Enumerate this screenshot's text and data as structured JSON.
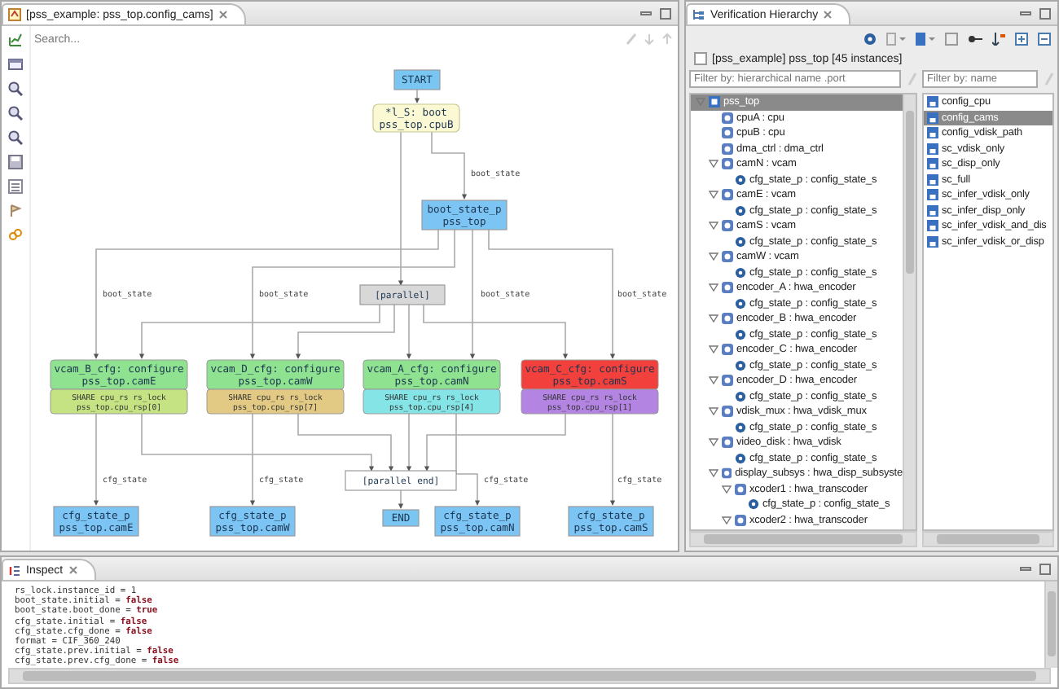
{
  "editor": {
    "tab_title": "[pss_example: pss_top.config_cams]",
    "search": {
      "placeholder": "Search..."
    },
    "diagram": {
      "nodes": [
        {
          "kind": "terminal",
          "lines": [
            "START"
          ]
        },
        {
          "kind": "atomic",
          "lines": [
            "*l_S: boot",
            "pss_top.cpuB"
          ]
        },
        {
          "kind": "state",
          "lines": [
            "boot_state_p",
            "pss_top"
          ]
        },
        {
          "kind": "fork",
          "lines": [
            "[parallel]"
          ]
        },
        {
          "kind": "action",
          "lines": [
            "vcam_B_cfg: configure",
            "pss_top.camE"
          ],
          "share": [
            "SHARE cpu_rs rs_lock",
            "pss_top.cpu_rsp[0]"
          ],
          "color": "#c5e383",
          "selected": false
        },
        {
          "kind": "action",
          "lines": [
            "vcam_D_cfg: configure",
            "pss_top.camW"
          ],
          "share": [
            "SHARE cpu_rs rs_lock",
            "pss_top.cpu_rsp[7]"
          ],
          "color": "#e2c984",
          "selected": false
        },
        {
          "kind": "action",
          "lines": [
            "vcam_A_cfg: configure",
            "pss_top.camN"
          ],
          "share": [
            "SHARE cpu_rs rs_lock",
            "pss_top.cpu_rsp[4]"
          ],
          "color": "#84e4e6",
          "selected": false
        },
        {
          "kind": "action",
          "lines": [
            "vcam_C_cfg: configure",
            "pss_top.camS"
          ],
          "share": [
            "SHARE cpu_rs rs_lock",
            "pss_top.cpu_rsp[1]"
          ],
          "color": "#b384e2",
          "selected": true
        },
        {
          "kind": "join",
          "lines": [
            "[parallel end]"
          ]
        },
        {
          "kind": "state",
          "lines": [
            "cfg_state_p",
            "pss_top.camE"
          ]
        },
        {
          "kind": "state",
          "lines": [
            "cfg_state_p",
            "pss_top.camW"
          ]
        },
        {
          "kind": "terminal",
          "lines": [
            "END"
          ]
        },
        {
          "kind": "state",
          "lines": [
            "cfg_state_p",
            "pss_top.camN"
          ]
        },
        {
          "kind": "state",
          "lines": [
            "cfg_state_p",
            "pss_top.camS"
          ]
        }
      ],
      "edge_labels": [
        "boot_state",
        "boot_state",
        "boot_state",
        "boot_state",
        "boot_state",
        "cfg_state",
        "cfg_state",
        "cfg_state",
        "cfg_state"
      ]
    }
  },
  "hierarchy": {
    "title": "Verification Hierarchy",
    "scope": {
      "label": "[pss_example] pss_top [45 instances]",
      "checked": false
    },
    "tree_filter": {
      "placeholder": "Filter by: hierarchical name .port"
    },
    "list_filter": {
      "placeholder": "Filter by: name"
    },
    "tree": [
      {
        "kind": "root",
        "label": "pss_top",
        "expanded": true,
        "selected": true,
        "children": [
          {
            "kind": "instance",
            "label": "cpuA : cpu",
            "selected": false
          },
          {
            "kind": "instance",
            "label": "cpuB : cpu",
            "selected": false
          },
          {
            "kind": "instance",
            "label": "dma_ctrl : dma_ctrl",
            "selected": false
          },
          {
            "kind": "instance",
            "label": "camN : vcam",
            "expanded": true,
            "selected": false,
            "children": [
              {
                "kind": "port",
                "label": "cfg_state_p : config_state_s",
                "selected": false
              }
            ]
          },
          {
            "kind": "instance",
            "label": "camE : vcam",
            "expanded": true,
            "selected": false,
            "children": [
              {
                "kind": "port",
                "label": "cfg_state_p : config_state_s",
                "selected": false
              }
            ]
          },
          {
            "kind": "instance",
            "label": "camS : vcam",
            "expanded": true,
            "selected": false,
            "children": [
              {
                "kind": "port",
                "label": "cfg_state_p : config_state_s",
                "selected": false
              }
            ]
          },
          {
            "kind": "instance",
            "label": "camW : vcam",
            "expanded": true,
            "selected": false,
            "children": [
              {
                "kind": "port",
                "label": "cfg_state_p : config_state_s",
                "selected": false
              }
            ]
          },
          {
            "kind": "instance",
            "label": "encoder_A : hwa_encoder",
            "expanded": true,
            "selected": false,
            "children": [
              {
                "kind": "port",
                "label": "cfg_state_p : config_state_s",
                "selected": false
              }
            ]
          },
          {
            "kind": "instance",
            "label": "encoder_B : hwa_encoder",
            "expanded": true,
            "selected": false,
            "children": [
              {
                "kind": "port",
                "label": "cfg_state_p : config_state_s",
                "selected": false
              }
            ]
          },
          {
            "kind": "instance",
            "label": "encoder_C : hwa_encoder",
            "expanded": true,
            "selected": false,
            "children": [
              {
                "kind": "port",
                "label": "cfg_state_p : config_state_s",
                "selected": false
              }
            ]
          },
          {
            "kind": "instance",
            "label": "encoder_D : hwa_encoder",
            "expanded": true,
            "selected": false,
            "children": [
              {
                "kind": "port",
                "label": "cfg_state_p : config_state_s",
                "selected": false
              }
            ]
          },
          {
            "kind": "instance",
            "label": "vdisk_mux : hwa_vdisk_mux",
            "expanded": true,
            "selected": false,
            "children": [
              {
                "kind": "port",
                "label": "cfg_state_p : config_state_s",
                "selected": false
              }
            ]
          },
          {
            "kind": "instance",
            "label": "video_disk : hwa_vdisk",
            "expanded": true,
            "selected": false,
            "children": [
              {
                "kind": "port",
                "label": "cfg_state_p : config_state_s",
                "selected": false
              }
            ]
          },
          {
            "kind": "instance",
            "label": "display_subsys : hwa_disp_subsyste",
            "expanded": true,
            "selected": false,
            "children": [
              {
                "kind": "instance",
                "label": "xcoder1 : hwa_transcoder",
                "expanded": true,
                "selected": false,
                "children": [
                  {
                    "kind": "port",
                    "label": "cfg_state_p : config_state_s",
                    "selected": false
                  }
                ]
              },
              {
                "kind": "instance",
                "label": "xcoder2 : hwa_transcoder",
                "expanded": true,
                "selected": false
              }
            ]
          }
        ]
      }
    ],
    "actions": [
      {
        "label": "config_cpu",
        "selected": false
      },
      {
        "label": "config_cams",
        "selected": true
      },
      {
        "label": "config_vdisk_path",
        "selected": false
      },
      {
        "label": "sc_vdisk_only",
        "selected": false
      },
      {
        "label": "sc_disp_only",
        "selected": false
      },
      {
        "label": "sc_full",
        "selected": false
      },
      {
        "label": "sc_infer_vdisk_only",
        "selected": false
      },
      {
        "label": "sc_infer_disp_only",
        "selected": false
      },
      {
        "label": "sc_infer_vdisk_and_dis",
        "selected": false
      },
      {
        "label": "sc_infer_vdisk_or_disp",
        "selected": false
      }
    ]
  },
  "inspect": {
    "title": "Inspect",
    "lines": [
      "rs_lock.instance_id = 1",
      "boot_state.initial = **false**",
      "boot_state.boot_done = **true**",
      "cfg_state.initial = **false**",
      "cfg_state.cfg_done = **false**",
      "format = CIF_360_240",
      "cfg_state.prev.initial = **false**",
      "cfg_state.prev.cfg_done = **false**"
    ]
  }
}
